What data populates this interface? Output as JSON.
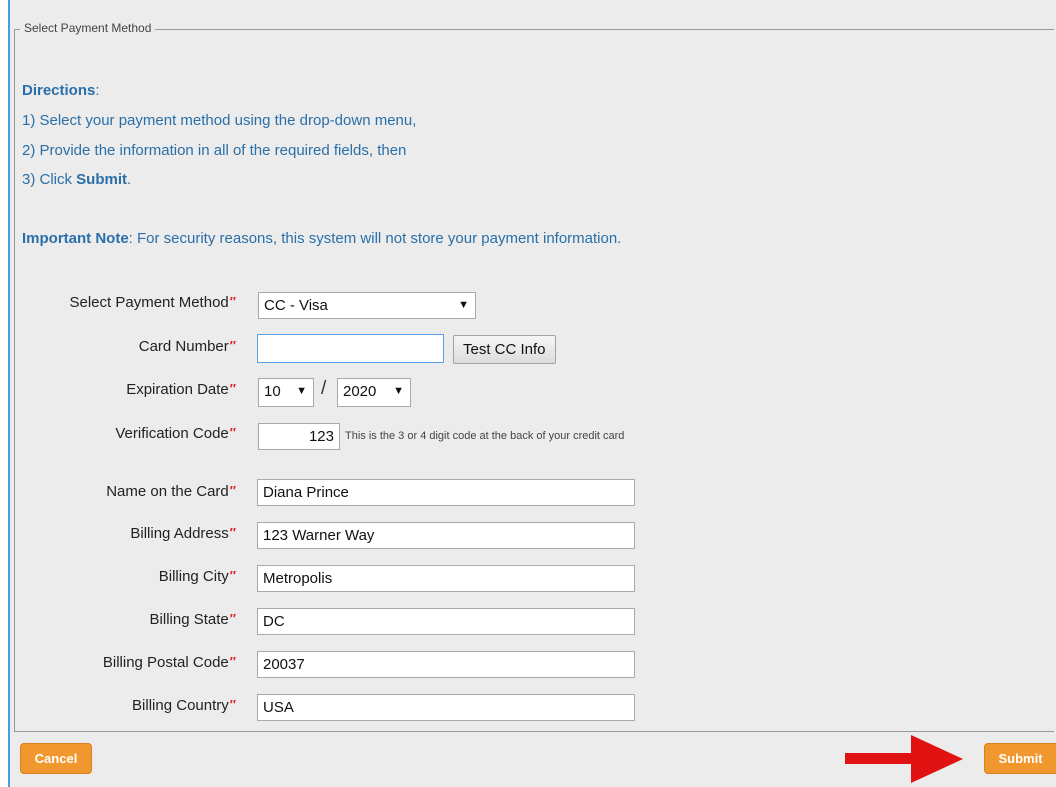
{
  "fieldset": {
    "legend": "Select Payment Method"
  },
  "directions": {
    "heading": "Directions",
    "heading_suffix": ":",
    "step1": "1) Select your payment method using the drop-down menu,",
    "step2": "2) Provide the information in all of the required fields, then",
    "step3_prefix": "3) Click ",
    "step3_bold": "Submit",
    "step3_suffix": ".",
    "note_label": "Important Note",
    "note_text": ": For security reasons, this system will not store your payment information."
  },
  "form": {
    "payment_method": {
      "label": "Select Payment Method",
      "value": "CC - Visa"
    },
    "card_number": {
      "label": "Card Number",
      "value": "",
      "test_button": "Test CC Info"
    },
    "expiration": {
      "label": "Expiration Date",
      "month": "10",
      "separator": "/",
      "year": "2020"
    },
    "verification": {
      "label": "Verification Code",
      "value": "123",
      "hint": "This is the 3 or 4 digit code at the back of your credit card"
    },
    "name": {
      "label": "Name on the Card",
      "value": "Diana Prince"
    },
    "address": {
      "label": "Billing Address",
      "value": "123 Warner Way"
    },
    "city": {
      "label": "Billing City",
      "value": "Metropolis"
    },
    "state": {
      "label": "Billing State",
      "value": "DC"
    },
    "postal": {
      "label": "Billing Postal Code",
      "value": "20037"
    },
    "country": {
      "label": "Billing Country",
      "value": "USA"
    }
  },
  "actions": {
    "cancel": "Cancel",
    "submit": "Submit"
  },
  "icons": {
    "dropdown": "caret-down-icon",
    "callout": "red-arrow-icon"
  },
  "colors": {
    "accent_text": "#2a6fa8",
    "button_orange": "#f0982e",
    "required": "#dd2222",
    "arrow": "#e01212"
  }
}
